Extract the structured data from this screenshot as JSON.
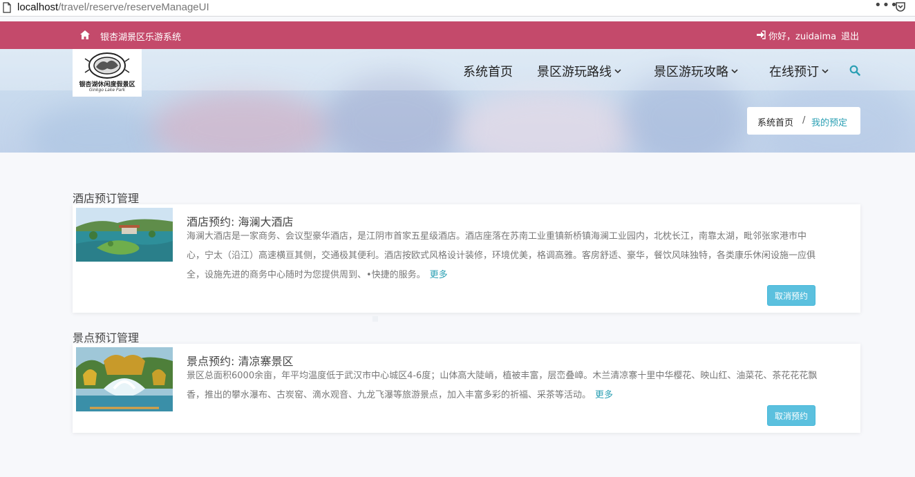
{
  "browser": {
    "url_host": "localhost",
    "url_path": "/travel/reserve/reserveManageUI",
    "menu_glyph": "•••"
  },
  "topbar": {
    "site_name": "银杏湖景区乐游系统",
    "greeting": "你好，zuidaima",
    "logout": "退出"
  },
  "logo": {
    "text": "银杏湖休闲度假景区",
    "subtext": "Ginkgo Lake Park"
  },
  "nav": {
    "items": [
      "系统首页",
      "景区游玩路线",
      "景区游玩攻略",
      "在线预订"
    ]
  },
  "breadcrumb": {
    "home": "系统首页",
    "separator": "/",
    "current": "我的预定"
  },
  "hotel_section": {
    "heading": "酒店预订管理",
    "title": "酒店预约: 海澜大酒店",
    "description": "海澜大酒店是一家商务、会议型豪华酒店，是江阴市首家五星级酒店。酒店座落在苏南工业重镇新桥镇海澜工业园内，北枕长江，南靠太湖，毗邻张家港市中心，宁太（沿江）高速横亘其侧，交通极其便利。酒店按欧式风格设计装修，环境优美，格调高雅。客房舒适、豪华，餐饮风味独特，各类康乐休闲设施一应俱全，设施先进的商务中心随时为您提供周到、•快捷的服务。",
    "more": "更多",
    "cancel": "取消预约"
  },
  "scenic_section": {
    "heading": "景点预订管理",
    "title": "景点预约: 清凉寨景区",
    "description": "景区总面积6000余亩，年平均温度低于武汉市中心城区4-6度；山体高大陡峭，植被丰富，层峦叠嶂。木兰清凉寨十里中华樱花、映山红、油菜花、茶花花花飘香，推出的攀水瀑布、古炭窑、滴水观音、九龙飞瀑等旅游景点，加入丰富多彩的祈福、采茶等活动。",
    "more": "更多",
    "cancel": "取消预约"
  },
  "colors": {
    "topbar": "#c44a6b",
    "accent": "#2a9fb3",
    "button": "#5bc0de"
  },
  "icons": [
    "page-icon",
    "pocket-icon",
    "home-icon",
    "sign-in-icon",
    "chevron-down-icon",
    "search-icon"
  ]
}
